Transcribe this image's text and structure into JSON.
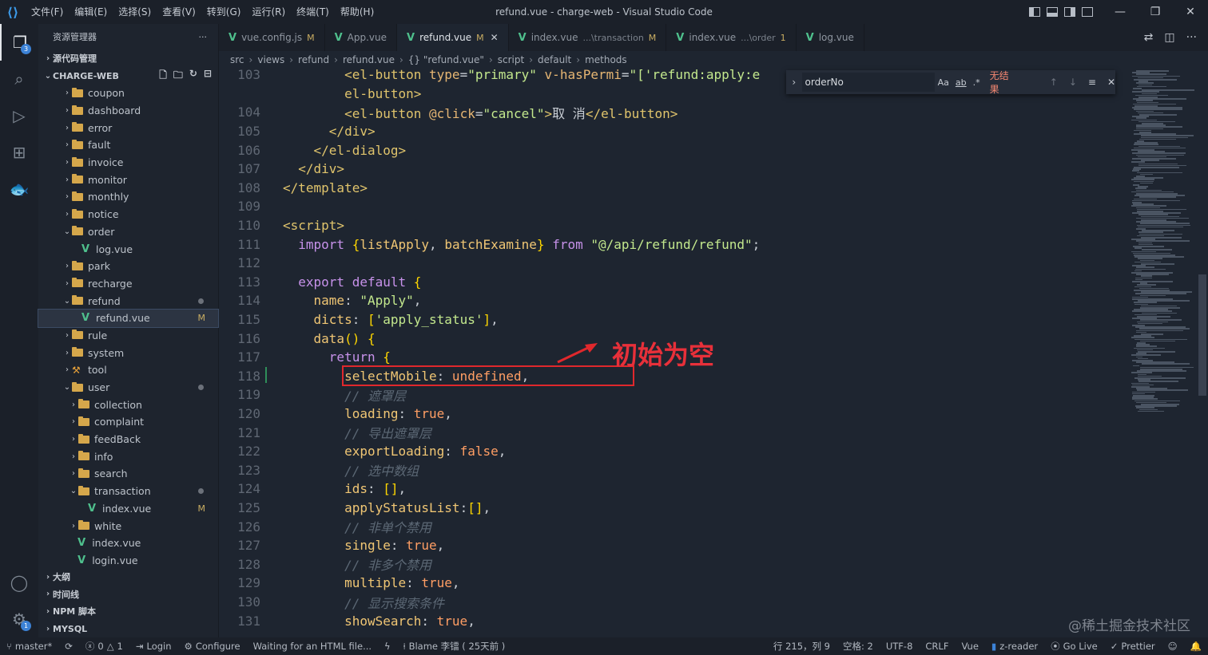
{
  "window": {
    "title": "refund.vue - charge-web - Visual Studio Code",
    "menu": [
      "文件(F)",
      "编辑(E)",
      "选择(S)",
      "查看(V)",
      "转到(G)",
      "运行(R)",
      "终端(T)",
      "帮助(H)"
    ]
  },
  "activity": {
    "explorer_badge": "3",
    "settings_badge": "1"
  },
  "sidebar": {
    "title": "资源管理器",
    "more": "···",
    "source_control": "源代码管理",
    "project": "CHARGE-WEB",
    "tree": [
      {
        "label": "coupon",
        "type": "folder",
        "depth": 1,
        "open": false
      },
      {
        "label": "dashboard",
        "type": "folder",
        "depth": 1,
        "open": false
      },
      {
        "label": "error",
        "type": "folder",
        "depth": 1,
        "open": false
      },
      {
        "label": "fault",
        "type": "folder",
        "depth": 1,
        "open": false
      },
      {
        "label": "invoice",
        "type": "folder",
        "depth": 1,
        "open": false
      },
      {
        "label": "monitor",
        "type": "folder",
        "depth": 1,
        "open": false
      },
      {
        "label": "monthly",
        "type": "folder",
        "depth": 1,
        "open": false
      },
      {
        "label": "notice",
        "type": "folder",
        "depth": 1,
        "open": false
      },
      {
        "label": "order",
        "type": "folder",
        "depth": 1,
        "open": true
      },
      {
        "label": "log.vue",
        "type": "vue",
        "depth": 2
      },
      {
        "label": "park",
        "type": "folder",
        "depth": 1,
        "open": false
      },
      {
        "label": "recharge",
        "type": "folder",
        "depth": 1,
        "open": false
      },
      {
        "label": "refund",
        "type": "folder",
        "depth": 1,
        "open": true,
        "dot": true
      },
      {
        "label": "refund.vue",
        "type": "vue",
        "depth": 2,
        "mark": "M",
        "selected": true
      },
      {
        "label": "rule",
        "type": "folder",
        "depth": 1,
        "open": false
      },
      {
        "label": "system",
        "type": "folder",
        "depth": 1,
        "open": false
      },
      {
        "label": "tool",
        "type": "tool",
        "depth": 1,
        "open": false
      },
      {
        "label": "user",
        "type": "folder",
        "depth": 1,
        "open": true,
        "dot": true
      },
      {
        "label": "collection",
        "type": "folder",
        "depth": 2,
        "open": false
      },
      {
        "label": "complaint",
        "type": "folder",
        "depth": 2,
        "open": false
      },
      {
        "label": "feedBack",
        "type": "folder",
        "depth": 2,
        "open": false
      },
      {
        "label": "info",
        "type": "folder",
        "depth": 2,
        "open": false
      },
      {
        "label": "search",
        "type": "folder",
        "depth": 2,
        "open": false
      },
      {
        "label": "transaction",
        "type": "folder",
        "depth": 2,
        "open": true,
        "dot": true
      },
      {
        "label": "index.vue",
        "type": "vue",
        "depth": 3,
        "mark": "M"
      },
      {
        "label": "white",
        "type": "folder",
        "depth": 2,
        "open": false
      },
      {
        "label": "index.vue",
        "type": "vue",
        "depth": 1.4
      },
      {
        "label": "login.vue",
        "type": "vue",
        "depth": 1.4
      }
    ],
    "bottom_sections": [
      "大纲",
      "时间线",
      "NPM 脚本",
      "MYSQL"
    ]
  },
  "tabs": [
    {
      "label": "vue.config.js",
      "mark": "M",
      "desc": "",
      "active": false
    },
    {
      "label": "App.vue",
      "mark": "",
      "desc": "",
      "active": false
    },
    {
      "label": "refund.vue",
      "mark": "M",
      "desc": "",
      "active": true
    },
    {
      "label": "index.vue",
      "mark": "M",
      "desc": "...\\transaction",
      "active": false
    },
    {
      "label": "index.vue",
      "mark": "1",
      "desc": "...\\order",
      "active": false
    },
    {
      "label": "log.vue",
      "mark": "",
      "desc": "",
      "active": false
    }
  ],
  "breadcrumb": [
    "src",
    "views",
    "refund",
    "refund.vue",
    "{} \"refund.vue\"",
    "script",
    "default",
    "methods"
  ],
  "find": {
    "value": "orderNo",
    "opt_case": "Aa",
    "opt_word": "ab",
    "opt_regex": ".*",
    "result": "无结果",
    "up": "↑",
    "down": "↓",
    "sel": "≡",
    "close": "✕"
  },
  "code": [
    {
      "n": "103",
      "html": "<span class='p'>        </span><span class='k'>&lt;el-button</span> <span class='at'>type</span><span class='p'>=</span><span class='s'>\"primary\"</span> <span class='at'>v-hasPermi</span><span class='p'>=</span><span class='s'>\"['refund:apply:e</span>"
    },
    {
      "n": "",
      "html": "<span class='p'>        </span><span class='k'>el-button&gt;</span>"
    },
    {
      "n": "104",
      "html": "<span class='p'>        </span><span class='k'>&lt;el-button</span> <span class='at'>@click</span><span class='p'>=</span><span class='s'>\"cancel\"</span><span class='k'>&gt;</span><span class='p'>取 消</span><span class='k'>&lt;/el-button&gt;</span>"
    },
    {
      "n": "105",
      "html": "<span class='p'>      </span><span class='k'>&lt;/div&gt;</span>"
    },
    {
      "n": "106",
      "html": "<span class='p'>    </span><span class='k'>&lt;/el-dialog&gt;</span>"
    },
    {
      "n": "107",
      "html": "<span class='p'>  </span><span class='k'>&lt;/div&gt;</span>"
    },
    {
      "n": "108",
      "html": "<span class='k'>&lt;/template&gt;</span>"
    },
    {
      "n": "109",
      "html": ""
    },
    {
      "n": "110",
      "html": "<span class='k'>&lt;script&gt;</span>"
    },
    {
      "n": "111",
      "html": "<span class='p'>  </span><span class='kw'>import</span> <span class='br'>{</span><span class='prop'>listApply</span><span class='p'>, </span><span class='prop'>batchExamine</span><span class='br'>}</span> <span class='kw'>from</span> <span class='s'>\"@/api/refund/refund\"</span><span class='p'>;</span>"
    },
    {
      "n": "112",
      "html": ""
    },
    {
      "n": "113",
      "html": "<span class='p'>  </span><span class='kw'>export default</span> <span class='br'>{</span>"
    },
    {
      "n": "114",
      "html": "<span class='p'>    </span><span class='prop'>name</span><span class='p'>: </span><span class='s'>\"Apply\"</span><span class='p'>,</span>"
    },
    {
      "n": "115",
      "html": "<span class='p'>    </span><span class='prop'>dicts</span><span class='p'>: </span><span class='br'>[</span><span class='s'>'apply_status'</span><span class='br'>]</span><span class='p'>,</span>"
    },
    {
      "n": "116",
      "html": "<span class='p'>    </span><span class='prop'>data</span><span class='br'>()</span> <span class='br'>{</span>"
    },
    {
      "n": "117",
      "html": "<span class='p'>      </span><span class='kw'>return</span> <span class='br'>{</span>"
    },
    {
      "n": "118",
      "html": "<span class='p'>        </span><span class='prop'>selectMobile</span><span class='p'>: </span><span class='val'>undefined</span><span class='p'>,</span>"
    },
    {
      "n": "119",
      "html": "<span class='p'>        </span><span class='cm'>// 遮罩层</span>"
    },
    {
      "n": "120",
      "html": "<span class='p'>        </span><span class='prop'>loading</span><span class='p'>: </span><span class='val'>true</span><span class='p'>,</span>"
    },
    {
      "n": "121",
      "html": "<span class='p'>        </span><span class='cm'>// 导出遮罩层</span>"
    },
    {
      "n": "122",
      "html": "<span class='p'>        </span><span class='prop'>exportLoading</span><span class='p'>: </span><span class='val'>false</span><span class='p'>,</span>"
    },
    {
      "n": "123",
      "html": "<span class='p'>        </span><span class='cm'>// 选中数组</span>"
    },
    {
      "n": "124",
      "html": "<span class='p'>        </span><span class='prop'>ids</span><span class='p'>: </span><span class='br'>[]</span><span class='p'>,</span>"
    },
    {
      "n": "125",
      "html": "<span class='p'>        </span><span class='prop'>applyStatusList</span><span class='p'>:</span><span class='br'>[]</span><span class='p'>,</span>"
    },
    {
      "n": "126",
      "html": "<span class='p'>        </span><span class='cm'>// 非单个禁用</span>"
    },
    {
      "n": "127",
      "html": "<span class='p'>        </span><span class='prop'>single</span><span class='p'>: </span><span class='val'>true</span><span class='p'>,</span>"
    },
    {
      "n": "128",
      "html": "<span class='p'>        </span><span class='cm'>// 非多个禁用</span>"
    },
    {
      "n": "129",
      "html": "<span class='p'>        </span><span class='prop'>multiple</span><span class='p'>: </span><span class='val'>true</span><span class='p'>,</span>"
    },
    {
      "n": "130",
      "html": "<span class='p'>        </span><span class='cm'>// 显示搜索条件</span>"
    },
    {
      "n": "131",
      "html": "<span class='p'>        </span><span class='prop'>showSearch</span><span class='p'>: </span><span class='val'>true</span><span class='p'>,</span>"
    }
  ],
  "annotation": "初始为空",
  "status": {
    "branch": "master*",
    "sync": "⟳",
    "errors": "0",
    "warnings": "1",
    "login": "Login",
    "configure": "Configure",
    "waiting": "Waiting for an HTML file...",
    "blame": "Blame 李镭 ( 25天前 )",
    "position": "行 215，列 9",
    "spaces": "空格: 2",
    "encoding": "UTF-8",
    "eol": "CRLF",
    "language": "Vue",
    "zreader": "z-reader",
    "golive": "Go Live",
    "prettier": "Prettier"
  },
  "watermark": "@稀土掘金技术社区"
}
